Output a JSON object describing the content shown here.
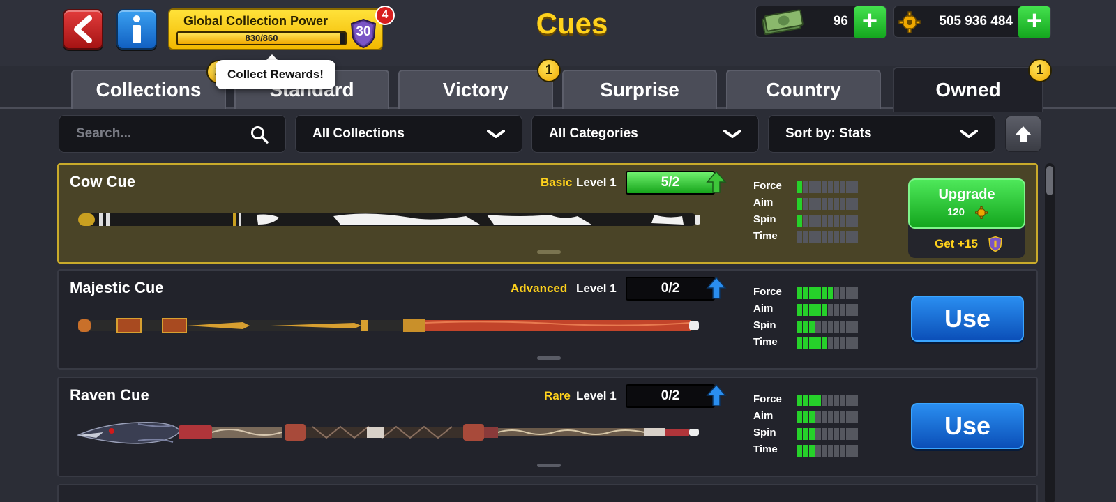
{
  "header": {
    "title": "Cues",
    "collection_power": {
      "label": "Global Collection Power",
      "progress_text": "830/860",
      "progress": 0.965,
      "level": "30",
      "notification_count": "4"
    },
    "cash": {
      "value": "96",
      "icon": "cash-icon"
    },
    "coins": {
      "value": "505 936 484",
      "icon": "coin-gear-icon"
    },
    "tooltip": "Collect Rewards!"
  },
  "tabs": [
    {
      "label": "Collections",
      "badge": "2",
      "active": false
    },
    {
      "label": "Standard",
      "badge": "",
      "active": false
    },
    {
      "label": "Victory",
      "badge": "1",
      "active": false
    },
    {
      "label": "Surprise",
      "badge": "",
      "active": false
    },
    {
      "label": "Country",
      "badge": "",
      "active": false
    },
    {
      "label": "Owned",
      "badge": "1",
      "active": true
    }
  ],
  "filters": {
    "search_placeholder": "Search...",
    "collections": "All Collections",
    "categories": "All Categories",
    "sort": "Sort by: Stats"
  },
  "stat_labels": {
    "force": "Force",
    "aim": "Aim",
    "spin": "Spin",
    "time": "Time"
  },
  "cues": [
    {
      "name": "Cow Cue",
      "rarity": "Basic",
      "level": "Level 1",
      "progress_text": "5/2",
      "progress": 1.0,
      "stats": {
        "force": 1,
        "aim": 1,
        "spin": 1,
        "time": 0
      },
      "action": "upgrade",
      "upgrade_label": "Upgrade",
      "upgrade_cost": "120",
      "bonus": "Get +15",
      "selected": true
    },
    {
      "name": "Majestic Cue",
      "rarity": "Advanced",
      "level": "Level 1",
      "progress_text": "0/2",
      "progress": 0,
      "stats": {
        "force": 6,
        "aim": 5,
        "spin": 3,
        "time": 5
      },
      "action": "use",
      "use_label": "Use",
      "selected": false
    },
    {
      "name": "Raven Cue",
      "rarity": "Rare",
      "level": "Level 1",
      "progress_text": "0/2",
      "progress": 0,
      "stats": {
        "force": 4,
        "aim": 3,
        "spin": 3,
        "time": 3
      },
      "action": "use",
      "use_label": "Use",
      "selected": false
    }
  ],
  "stat_max_segments": 10,
  "colors": {
    "accent_yellow": "#ffd21c",
    "stat_green": "#26d12a",
    "use_blue": "#0b4fb8",
    "upgrade_green": "#13a51d"
  }
}
